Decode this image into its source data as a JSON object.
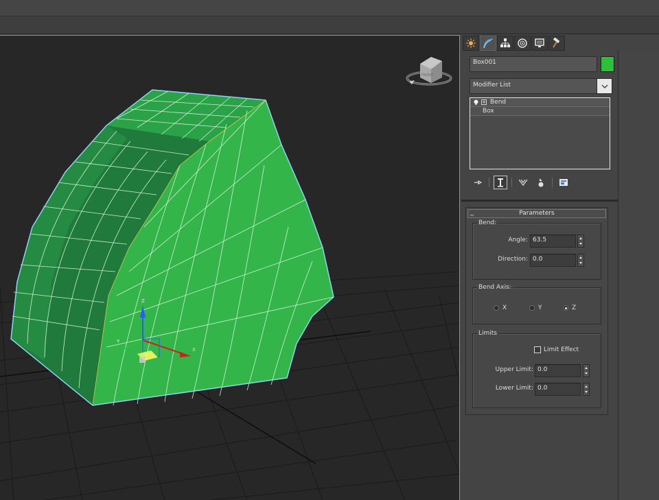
{
  "command_panel": {
    "tabs": [
      {
        "name": "create",
        "icon": "sun-icon"
      },
      {
        "name": "modify",
        "icon": "modify-arc-icon"
      },
      {
        "name": "hierarchy",
        "icon": "hierarchy-icon"
      },
      {
        "name": "motion",
        "icon": "motion-icon"
      },
      {
        "name": "display",
        "icon": "display-icon"
      },
      {
        "name": "utilities",
        "icon": "hammer-icon"
      }
    ],
    "active_tab": "modify",
    "object_name": "Box001",
    "object_color": "#2fbf3a",
    "modifier_list_label": "Modifier List",
    "stack": {
      "modifier": "Bend",
      "base_object": "Box"
    },
    "stack_tools": [
      "pin-stack-icon",
      "show-end-result-icon",
      "make-unique-icon",
      "remove-modifier-icon",
      "configure-modifier-sets-icon"
    ]
  },
  "parameters": {
    "title": "Parameters",
    "bend_group": "Bend:",
    "angle_label": "Angle:",
    "angle_value": "63.5",
    "direction_label": "Direction:",
    "direction_value": "0.0",
    "bend_axis_group": "Bend Axis:",
    "axis_x": "X",
    "axis_y": "Y",
    "axis_z": "Z",
    "selected_axis": "Z",
    "limits_group": "Limits",
    "limit_effect_label": "Limit Effect",
    "limit_effect_checked": false,
    "upper_limit_label": "Upper Limit:",
    "upper_limit_value": "0.0",
    "lower_limit_label": "Lower Limit:",
    "lower_limit_value": "0.0"
  },
  "viewport": {
    "gizmo_axes": {
      "x": "X",
      "y": "Y",
      "z": "Z"
    },
    "object_color": "#2fbf3a",
    "viewcube_face": "FRONT"
  },
  "colors": {
    "accent_border": "#b8962e",
    "mesh_face_light": "#36b94c",
    "mesh_face_dark": "#1f6f38",
    "selection_outline": "#8fd4f4"
  }
}
